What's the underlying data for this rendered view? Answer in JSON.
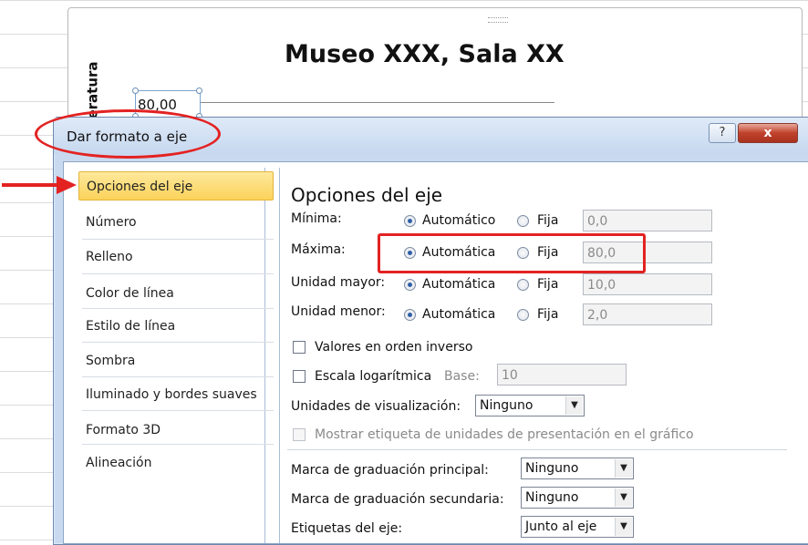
{
  "chart": {
    "title": "Museo XXX, Sala XX",
    "axis_title_fragment": "eratura",
    "axis_max_label": "80,00"
  },
  "dialog": {
    "title": "Dar formato a eje",
    "help_label": "?",
    "close_label": "x"
  },
  "nav": {
    "items": [
      {
        "label": "Opciones del eje",
        "active": true
      },
      {
        "label": "Número"
      },
      {
        "label": "Relleno"
      },
      {
        "label": "Color de línea"
      },
      {
        "label": "Estilo de línea"
      },
      {
        "label": "Sombra"
      },
      {
        "label": "Iluminado y bordes suaves"
      },
      {
        "label": "Formato 3D"
      },
      {
        "label": "Alineación"
      }
    ]
  },
  "options": {
    "section_title": "Opciones del eje",
    "rows": [
      {
        "label": "Mínima:",
        "auto_label": "Automático",
        "fixed_label": "Fija",
        "value": "0,0"
      },
      {
        "label": "Máxima:",
        "auto_label": "Automática",
        "fixed_label": "Fija",
        "value": "80,0"
      },
      {
        "label": "Unidad mayor:",
        "auto_label": "Automática",
        "fixed_label": "Fija",
        "value": "10,0"
      },
      {
        "label": "Unidad menor:",
        "auto_label": "Automática",
        "fixed_label": "Fija",
        "value": "2,0"
      }
    ],
    "reverse_label": "Valores en orden inverso",
    "log_label": "Escala logarítmica",
    "base_label": "Base:",
    "base_value": "10",
    "display_units_label": "Unidades de visualización:",
    "display_units_value": "Ninguno",
    "show_units_label": "Mostrar etiqueta de unidades de presentación en el gráfico",
    "major_tick_label": "Marca de graduación principal:",
    "major_tick_value": "Ninguno",
    "minor_tick_label": "Marca de graduación secundaria:",
    "minor_tick_value": "Ninguno",
    "axis_labels_label": "Etiquetas del eje:",
    "axis_labels_value": "Junto al eje"
  },
  "colors": {
    "annotation": "#e32222",
    "active_nav": "#fcd35a",
    "dialog_frame": "#c9daf0"
  },
  "icons": [
    "close-icon",
    "help-icon",
    "dropdown-arrow-icon",
    "radio-icon",
    "checkbox-icon"
  ]
}
